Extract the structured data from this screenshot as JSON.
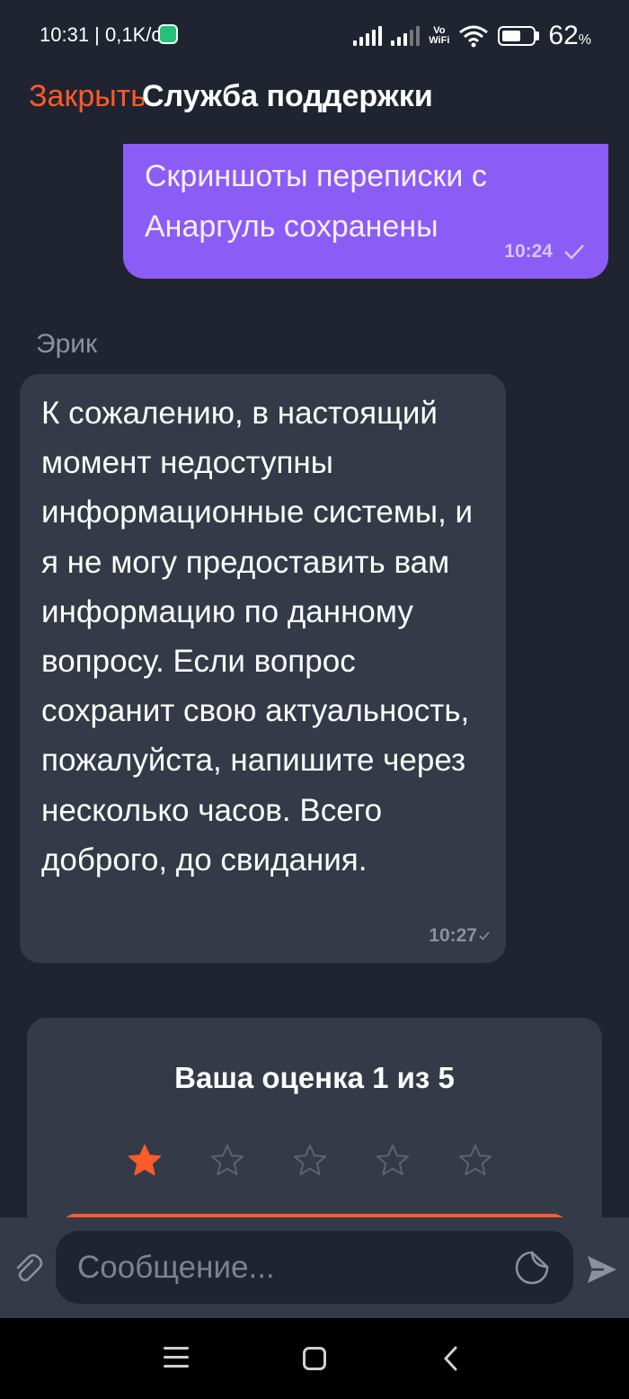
{
  "status_bar": {
    "time_speed": "10:31 | 0,1K/c",
    "vowifi_top": "Vo",
    "vowifi_bottom": "WiFi",
    "battery": "62",
    "battery_unit": "%",
    "battery_level": 0.62
  },
  "header": {
    "close_label": "Закрыть",
    "title": "Служба поддержки"
  },
  "messages": {
    "outgoing": {
      "text": "Скриншоты переписки с Анаргуль сохранены",
      "time": "10:24"
    },
    "incoming": {
      "sender": "Эрик",
      "text": "К сожалению, в настоящий момент недоступны информационные системы, и я не могу предоставить вам информацию по данному вопросу. Если вопрос сохранит свою актуальность, пожалуйста, напишите через несколько часов. Всего доброго, до свидания.",
      "time": "10:27"
    }
  },
  "rating": {
    "title": "Ваша оценка 1 из 5",
    "value": 1,
    "max": 5
  },
  "composer": {
    "placeholder": "Сообщение..."
  },
  "colors": {
    "accent": "#ff5a2a",
    "outgoing_bubble": "#8c5cf6",
    "incoming_bubble": "#343a47",
    "background": "#1f2430"
  },
  "icons": {
    "attach": "paperclip-icon",
    "sticker": "sticker-icon",
    "send": "send-icon",
    "star_filled": "star-filled-icon",
    "star_empty": "star-outline-icon"
  }
}
